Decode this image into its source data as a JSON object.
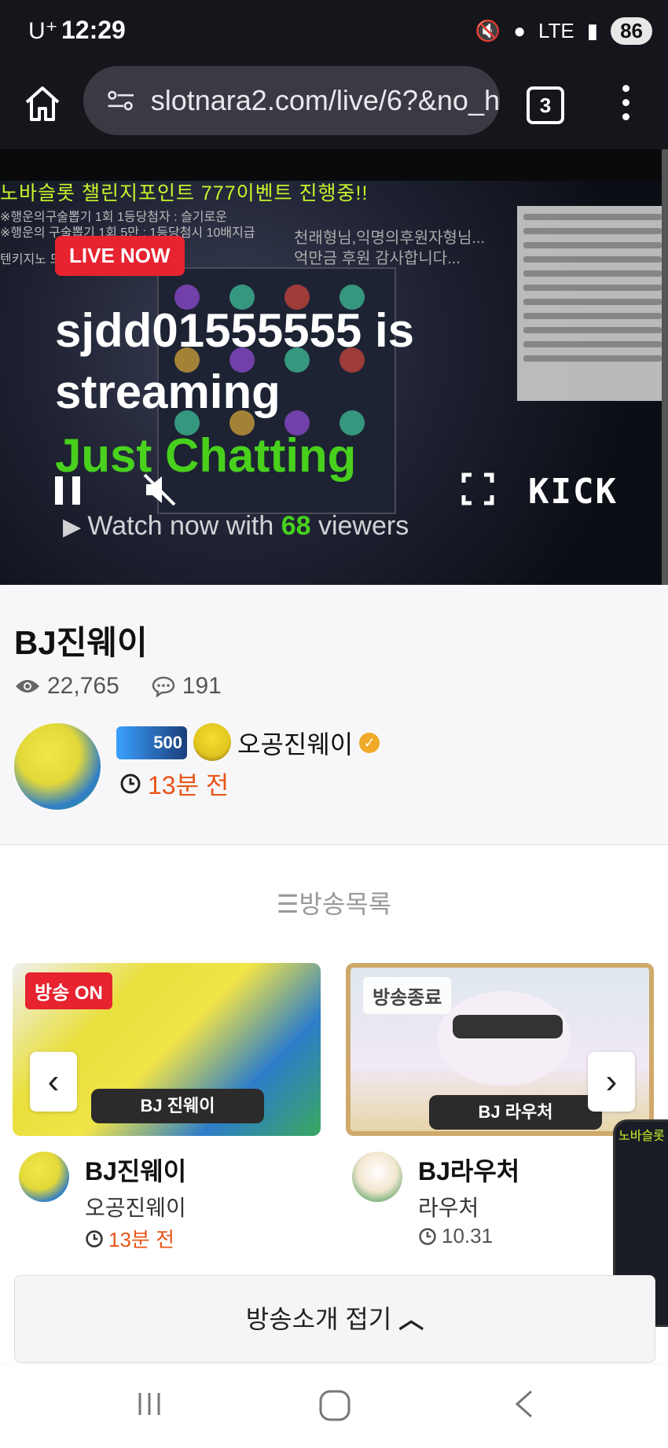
{
  "status_bar": {
    "carrier": "U⁺",
    "time": "12:29",
    "network": "LTE",
    "battery": "86"
  },
  "browser": {
    "url": "slotnara2.com/live/6?&no_h",
    "tab_count": "3"
  },
  "player": {
    "overlay_title": "노바슬롯 챌린지포인트 777이벤트 진행중!!",
    "overlay_line1": "※행운의구술뽑기 1회 1등당첨자 : 슬기로운",
    "overlay_line2": "※행운의 구술뽑기 1회 5만 : 1등당첨시 10배지급",
    "overlay_line3": "텐키지노                        드립니다",
    "thanks_line1": "천래형님,익명의후원자형님...",
    "thanks_line2": "억만금 후원 감사합니다...",
    "live_badge": "LIVE NOW",
    "stream_title": "sjdd01555555 is streaming",
    "category": "Just Chatting",
    "watch_prefix": "Watch now with ",
    "viewer_count": "68",
    "watch_suffix": " viewers",
    "kick_logo": "KICK"
  },
  "info": {
    "title": "BJ진웨이",
    "views": "22,765",
    "comments": "191",
    "badge": "500",
    "nickname": "오공진웨이",
    "posted": "13분 전"
  },
  "broadcast_list": {
    "heading": "방송목록",
    "cards": [
      {
        "status": "방송 ON",
        "plate": "BJ 진웨이",
        "title": "BJ진웨이",
        "subtitle": "오공진웨이",
        "time": "13분 전",
        "time_color": "#e8561a"
      },
      {
        "status": "방송종료",
        "plate": "BJ 라우처",
        "title": "BJ라우처",
        "subtitle": "라우처",
        "time": "10.31",
        "time_color": "#555555"
      }
    ],
    "collapse_label": "방송소개 접기"
  },
  "pip": {
    "text": "노바슬롯"
  },
  "colors": {
    "live_red": "#e6232f",
    "kick_green": "#53fc18",
    "orange": "#e8561a"
  }
}
